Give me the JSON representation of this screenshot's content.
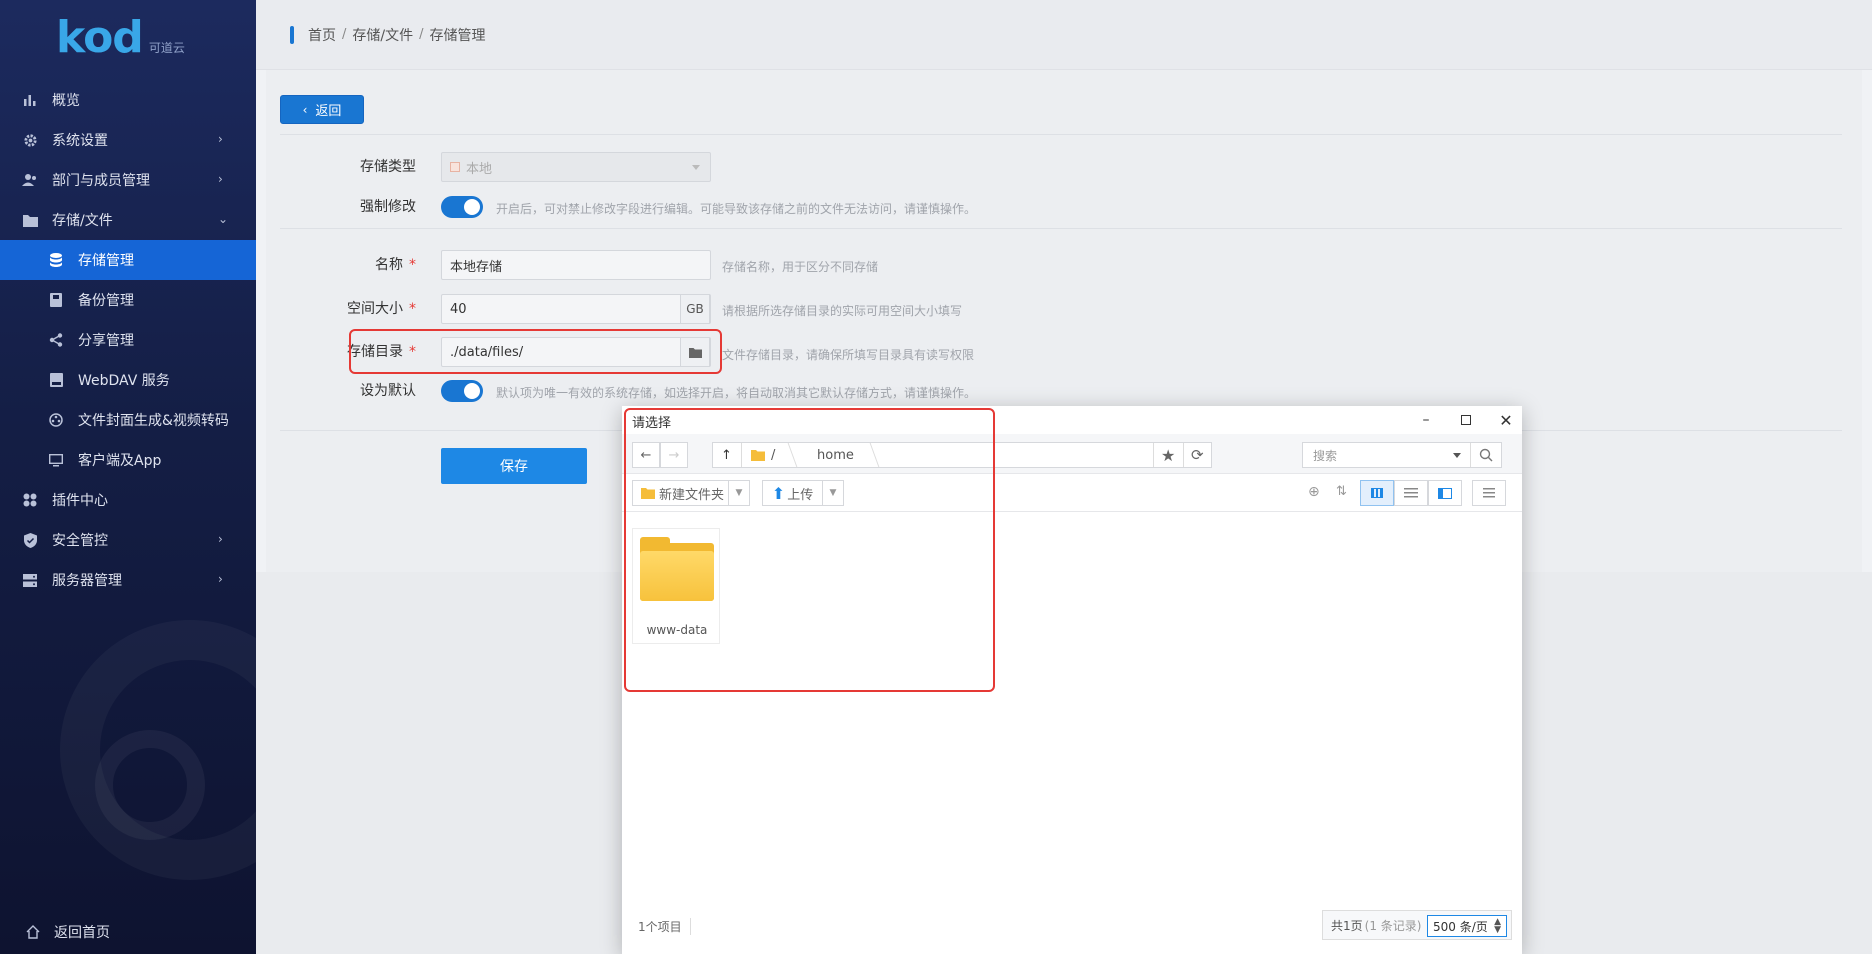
{
  "sidebar": {
    "logo": {
      "brand": "kod",
      "sub": "可道云"
    },
    "items": [
      {
        "label": "概览",
        "icon": "chart-icon"
      },
      {
        "label": "系统设置",
        "icon": "gear-icon"
      },
      {
        "label": "部门与成员管理",
        "icon": "users-icon"
      },
      {
        "label": "存储/文件",
        "icon": "folder-icon"
      },
      {
        "label": "存储管理",
        "icon": "database-icon"
      },
      {
        "label": "备份管理",
        "icon": "backup-icon"
      },
      {
        "label": "分享管理",
        "icon": "share-icon"
      },
      {
        "label": "WebDAV 服务",
        "icon": "webdav-icon"
      },
      {
        "label": "文件封面生成&视频转码",
        "icon": "video-icon"
      },
      {
        "label": "客户端及App",
        "icon": "monitor-icon"
      },
      {
        "label": "插件中心",
        "icon": "plugin-icon"
      },
      {
        "label": "安全管控",
        "icon": "shield-icon"
      },
      {
        "label": "服务器管理",
        "icon": "server-icon"
      }
    ],
    "bottom": "返回首页"
  },
  "breadcrumb": [
    "首页",
    "存储/文件",
    "存储管理"
  ],
  "form": {
    "back": "返回",
    "storage_type_label": "存储类型",
    "storage_type_value": "本地",
    "force_edit_label": "强制修改",
    "force_edit_hint": "开启后，可对禁止修改字段进行编辑。可能导致该存储之前的文件无法访问，请谨慎操作。",
    "name_label": "名称",
    "name_value": "本地存储",
    "name_hint": "存储名称，用于区分不同存储",
    "size_label": "空间大小",
    "size_value": "40",
    "size_unit": "GB",
    "size_hint": "请根据所选存储目录的实际可用空间大小填写",
    "dir_label": "存储目录",
    "dir_value": "./data/files/",
    "dir_hint": "文件存储目录，请确保所填写目录具有读写权限",
    "default_label": "设为默认",
    "default_hint": "默认项为唯一有效的系统存储，如选择开启，将自动取消其它默认存储方式，请谨慎操作。",
    "save": "保存",
    "required_mark": "*"
  },
  "dialog": {
    "title": "请选择",
    "path_root": "/",
    "path_home": "home",
    "search_placeholder": "搜索",
    "new_folder": "新建文件夹",
    "upload": "上传",
    "files": [
      {
        "name": "www-data",
        "type": "folder"
      }
    ],
    "item_count": "1个项目",
    "pager_total": "共1页",
    "pager_records": "(1 条记录)",
    "per_page": "500 条/页"
  },
  "colors": {
    "accent": "#1976d2",
    "highlight": "#e53935"
  }
}
